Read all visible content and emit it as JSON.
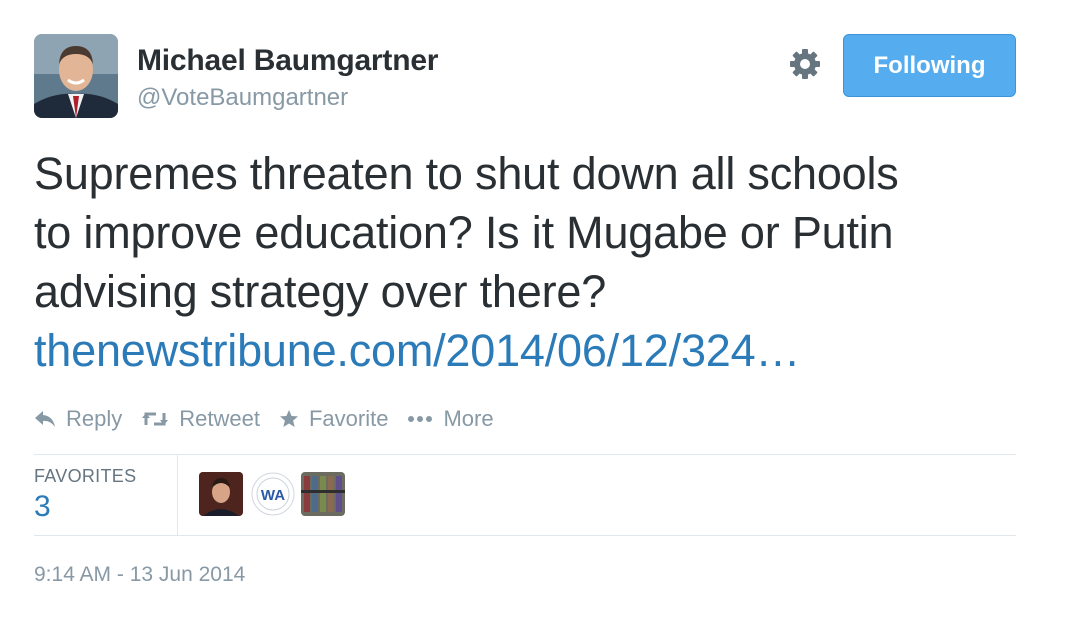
{
  "author": {
    "display_name": "Michael Baumgartner",
    "handle": "@VoteBaumgartner"
  },
  "header": {
    "follow_label": "Following"
  },
  "tweet": {
    "lines": [
      "Supremes threaten to shut down all schools",
      "to improve education? Is it Mugabe or Putin",
      "advising strategy over there?"
    ],
    "link": "thenewstribune.com/2014/06/12/324…"
  },
  "actions": {
    "reply": "Reply",
    "retweet": "Retweet",
    "favorite": "Favorite",
    "more": "More"
  },
  "stats": {
    "favorites_label": "FAVORITES",
    "favorites_count": "3",
    "favoriter_badge_text": "WA"
  },
  "timestamp": "9:14 AM - 13 Jun 2014",
  "colors": {
    "link": "#2b7bb9",
    "follow_button": "#55acee",
    "muted": "#8899a6",
    "text": "#292f33"
  }
}
